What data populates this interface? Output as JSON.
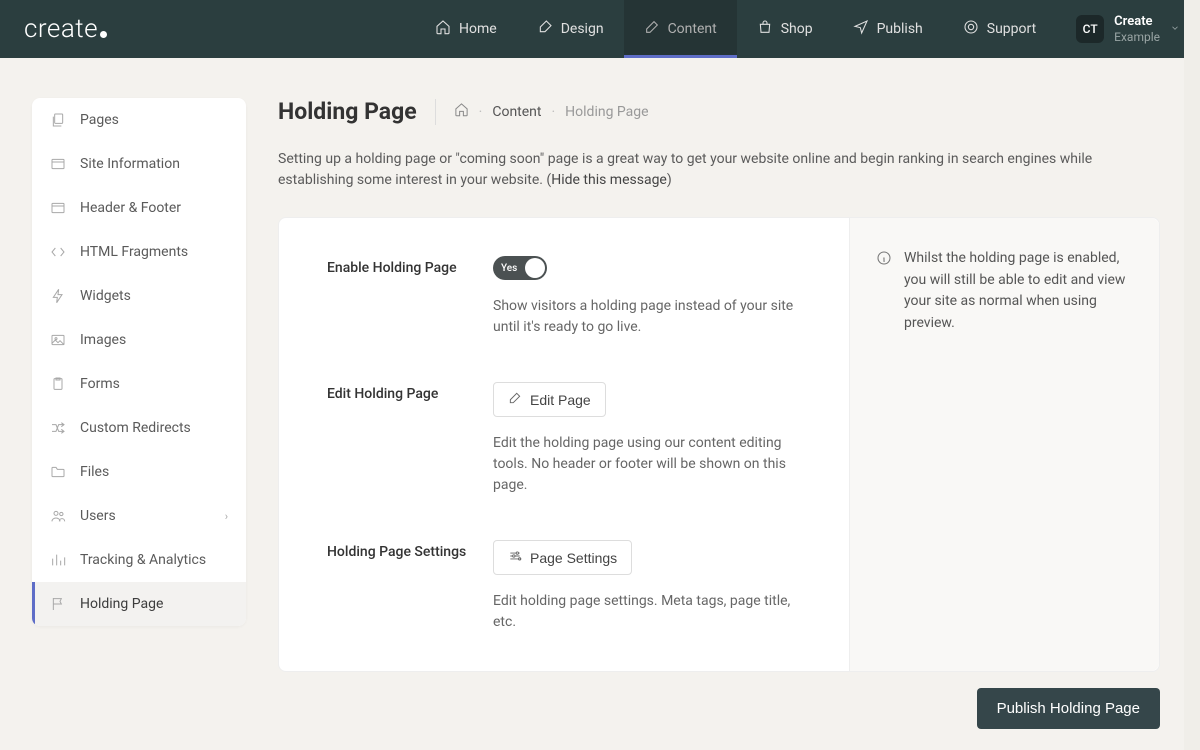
{
  "brand": "create",
  "nav": [
    {
      "label": "Home",
      "icon": "home"
    },
    {
      "label": "Design",
      "icon": "brush"
    },
    {
      "label": "Content",
      "icon": "edit",
      "active": true
    },
    {
      "label": "Shop",
      "icon": "bag"
    },
    {
      "label": "Publish",
      "icon": "send"
    },
    {
      "label": "Support",
      "icon": "help"
    }
  ],
  "user": {
    "initials": "CT",
    "name": "Create",
    "sub": "Example"
  },
  "sidebar": [
    {
      "label": "Pages",
      "icon": "copy"
    },
    {
      "label": "Site Information",
      "icon": "window"
    },
    {
      "label": "Header & Footer",
      "icon": "window"
    },
    {
      "label": "HTML Fragments",
      "icon": "code"
    },
    {
      "label": "Widgets",
      "icon": "bolt"
    },
    {
      "label": "Images",
      "icon": "image"
    },
    {
      "label": "Forms",
      "icon": "clipboard"
    },
    {
      "label": "Custom Redirects",
      "icon": "shuffle"
    },
    {
      "label": "Files",
      "icon": "folder"
    },
    {
      "label": "Users",
      "icon": "users",
      "expandable": true
    },
    {
      "label": "Tracking & Analytics",
      "icon": "stats"
    },
    {
      "label": "Holding Page",
      "icon": "flag",
      "active": true
    }
  ],
  "page": {
    "title": "Holding Page",
    "breadcrumb": {
      "section": "Content",
      "current": "Holding Page"
    },
    "intro_pre": "Setting up a holding page or \"coming soon\" page is a great way to get your website online and begin ranking in search engines while establishing some interest in your website. (",
    "intro_link": "Hide this message",
    "intro_post": ")",
    "fields": {
      "enable": {
        "label": "Enable Holding Page",
        "toggle": "Yes",
        "desc": "Show visitors a holding page instead of your site until it's ready to go live."
      },
      "edit": {
        "label": "Edit Holding Page",
        "button": "Edit Page",
        "desc": "Edit the holding page using our content editing tools. No header or footer will be shown on this page."
      },
      "settings": {
        "label": "Holding Page Settings",
        "button": "Page Settings",
        "desc": "Edit holding page settings. Meta tags, page title, etc."
      }
    },
    "info": "Whilst the holding page is enabled, you will still be able to edit and view your site as normal when using preview.",
    "publish_button": "Publish Holding Page"
  }
}
